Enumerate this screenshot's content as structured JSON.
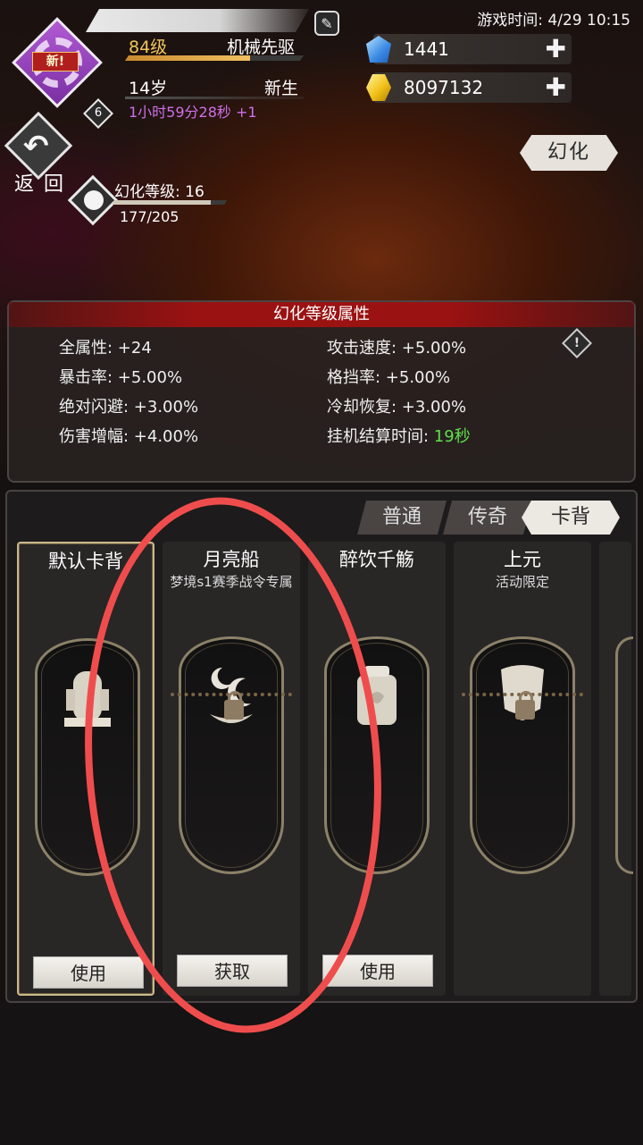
{
  "header": {
    "player_level": "84级",
    "player_title": "机械先驱",
    "player_age": "14岁",
    "player_stage": "新生",
    "timer_text": "1小时59分28秒 +1",
    "new_badge": "新!",
    "avatar_level": "6",
    "level_progress": 0.7,
    "edit_icon": "edit-icon"
  },
  "currencies": {
    "gems": "1441",
    "gold": "8097132",
    "plus": "✚"
  },
  "game_time": "游戏时间: 4/29 10:15",
  "nav": {
    "back_label": "返 回",
    "huahua_button": "幻化"
  },
  "huahua_level": {
    "label": "幻化等级: 16",
    "progress_text": "177/205",
    "progress": 0.863
  },
  "stats_panel": {
    "title": "幻化等级属性",
    "left": [
      "全属性: +24",
      "暴击率: +5.00%",
      "绝对闪避: +3.00%",
      "伤害增幅: +4.00%"
    ],
    "right": [
      "攻击速度: +5.00%",
      "格挡率: +5.00%",
      "冷却恢复: +3.00%"
    ],
    "idle_label": "挂机结算时间: ",
    "idle_value": "19秒",
    "info_icon": "!"
  },
  "tabs": [
    {
      "label": "普通",
      "active": false
    },
    {
      "label": "传奇",
      "active": false
    },
    {
      "label": "卡背",
      "active": true
    }
  ],
  "cards": [
    {
      "title": "默认卡背",
      "subtitle": "",
      "button": "使用",
      "locked": false,
      "selected": true,
      "art": "tombstone"
    },
    {
      "title": "月亮船",
      "subtitle": "梦境s1赛季战令专属",
      "button": "获取",
      "locked": true,
      "selected": false,
      "art": "moon-boat"
    },
    {
      "title": "醉饮千觞",
      "subtitle": "",
      "button": "使用",
      "locked": false,
      "selected": false,
      "art": "wine-jar"
    },
    {
      "title": "上元",
      "subtitle": "活动限定",
      "button": "",
      "locked": true,
      "selected": false,
      "art": "lantern"
    }
  ],
  "colors": {
    "accent_red": "#9b1212",
    "annotation_circle": "#ef4d4d",
    "green_value": "#5fe04d",
    "level_gold": "#f0c060"
  }
}
